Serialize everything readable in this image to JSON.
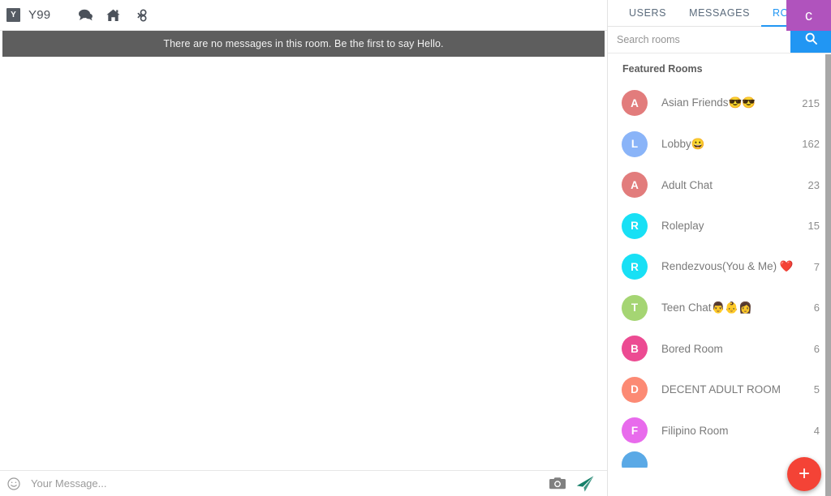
{
  "topbar": {
    "brand_initial": "Y",
    "brand_name": "Y99",
    "icons": [
      {
        "name": "chat-icon",
        "label": "Chat"
      },
      {
        "name": "home-icon",
        "label": "Home"
      },
      {
        "name": "link-icon",
        "label": "Link"
      }
    ],
    "user_avatar_letter": "c",
    "user_avatar_color": "#b053bd"
  },
  "notice": {
    "text": "There are no messages in this room. Be the first to say Hello.",
    "background": "#5e5e5e"
  },
  "composer": {
    "placeholder": "Your Message...",
    "value": "",
    "camera_label": "Camera",
    "send_label": "Send",
    "send_color": "#16806a"
  },
  "panel": {
    "tabs": [
      {
        "label": "USERS",
        "active": false
      },
      {
        "label": "MESSAGES",
        "active": false
      },
      {
        "label": "ROOMS",
        "active": true
      }
    ],
    "accent_color": "#2196f3",
    "search": {
      "placeholder": "Search rooms",
      "value": "",
      "button_icon": "search-icon"
    },
    "section_title": "Featured Rooms",
    "rooms": [
      {
        "initial": "A",
        "color": "#e27c7c",
        "name": "Asian Friends😎😎",
        "count": "215"
      },
      {
        "initial": "L",
        "color": "#8ab4f8",
        "name": "Lobby😀",
        "count": "162"
      },
      {
        "initial": "A",
        "color": "#e27c7c",
        "name": "Adult Chat",
        "count": "23"
      },
      {
        "initial": "R",
        "color": "#18e0f5",
        "name": "Roleplay",
        "count": "15"
      },
      {
        "initial": "R",
        "color": "#18e0f5",
        "name": "Rendezvous(You & Me) ❤️",
        "count": "7"
      },
      {
        "initial": "T",
        "color": "#a5d573",
        "name": "Teen Chat👨👶👩",
        "count": "6"
      },
      {
        "initial": "B",
        "color": "#ec4b92",
        "name": "Bored Room",
        "count": "6"
      },
      {
        "initial": "D",
        "color": "#fc8a74",
        "name": "DECENT ADULT ROOM",
        "count": "5"
      },
      {
        "initial": "F",
        "color": "#e86bec",
        "name": "Filipino Room",
        "count": "4"
      }
    ],
    "clipped_room": {
      "initial": "",
      "color": "#5aa9e6",
      "name": "",
      "count": ""
    },
    "fab": {
      "label": "+",
      "color": "#f44336"
    }
  }
}
